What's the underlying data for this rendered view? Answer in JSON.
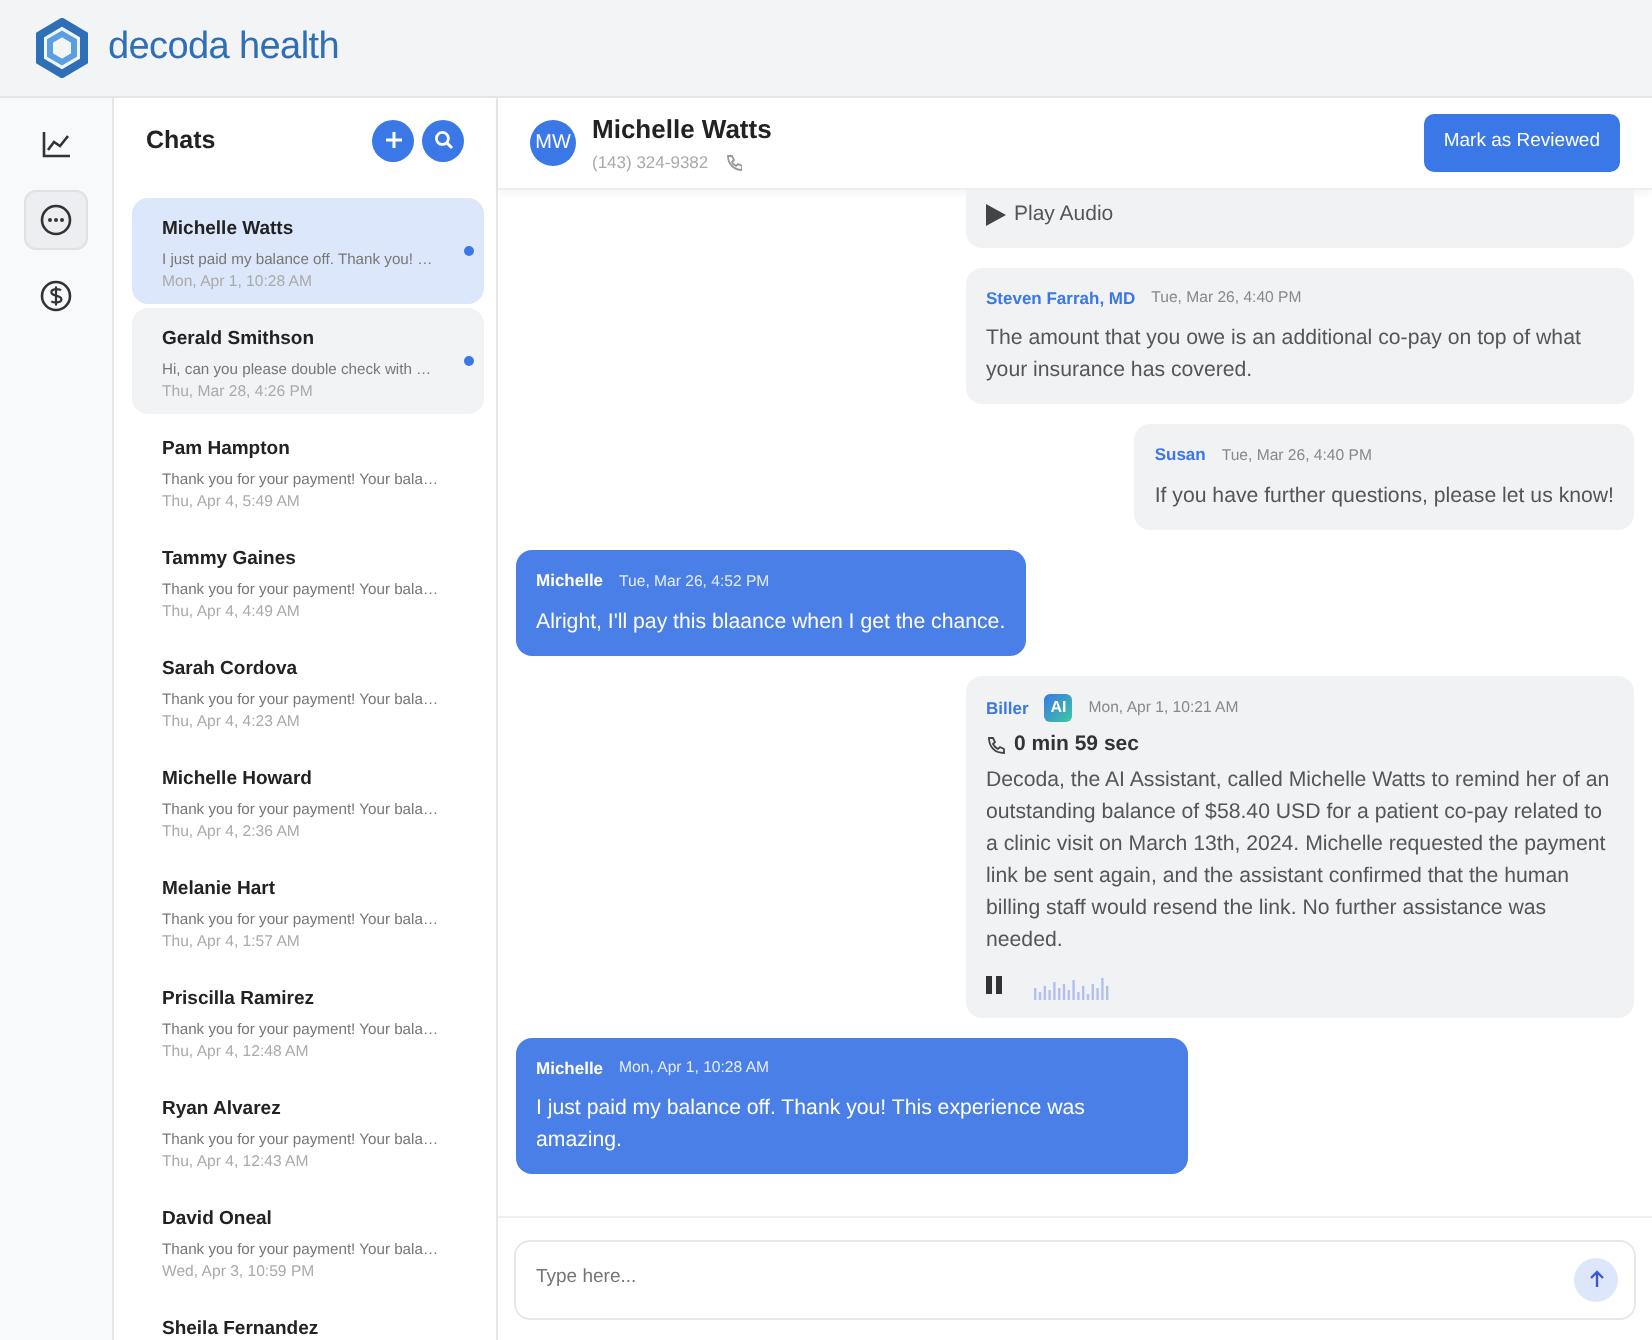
{
  "brand": {
    "name": "decoda health"
  },
  "rail": [
    {
      "kind": "chart",
      "selected": false
    },
    {
      "kind": "chat",
      "selected": true
    },
    {
      "kind": "dollar",
      "selected": false
    }
  ],
  "chats": {
    "title": "Chats",
    "items": [
      {
        "name": "Michelle Watts",
        "preview": "I just paid my balance off. Thank you! …",
        "time": "Mon, Apr 1, 10:28 AM",
        "selected": true,
        "unread": true
      },
      {
        "name": "Gerald Smithson",
        "preview": "Hi, can you please double check with …",
        "time": "Thu, Mar 28, 4:26 PM",
        "selected": false,
        "unread": true
      },
      {
        "name": "Pam Hampton",
        "preview": "Thank you for your payment! Your bala…",
        "time": "Thu, Apr 4, 5:49 AM",
        "selected": false,
        "unread": false
      },
      {
        "name": "Tammy Gaines",
        "preview": "Thank you for your payment! Your bala…",
        "time": "Thu, Apr 4, 4:49 AM",
        "selected": false,
        "unread": false
      },
      {
        "name": "Sarah Cordova",
        "preview": "Thank you for your payment! Your bala…",
        "time": "Thu, Apr 4, 4:23 AM",
        "selected": false,
        "unread": false
      },
      {
        "name": "Michelle Howard",
        "preview": "Thank you for your payment! Your bala…",
        "time": "Thu, Apr 4, 2:36 AM",
        "selected": false,
        "unread": false
      },
      {
        "name": "Melanie Hart",
        "preview": "Thank you for your payment! Your bala…",
        "time": "Thu, Apr 4, 1:57 AM",
        "selected": false,
        "unread": false
      },
      {
        "name": "Priscilla Ramirez",
        "preview": "Thank you for your payment! Your bala…",
        "time": "Thu, Apr 4, 12:48 AM",
        "selected": false,
        "unread": false
      },
      {
        "name": "Ryan Alvarez",
        "preview": "Thank you for your payment! Your bala…",
        "time": "Thu, Apr 4, 12:43 AM",
        "selected": false,
        "unread": false
      },
      {
        "name": "David Oneal",
        "preview": "Thank you for your payment! Your bala…",
        "time": "Wed, Apr 3, 10:59 PM",
        "selected": false,
        "unread": false
      },
      {
        "name": "Sheila Fernandez"
      }
    ]
  },
  "conversation": {
    "initials": "MW",
    "name": "Michelle Watts",
    "phone": "(143) 324-9382",
    "action": "Mark as Reviewed"
  },
  "messages": [
    {
      "kind": "audio",
      "label": "Play Audio"
    },
    {
      "kind": "staff",
      "sender": "Steven Farrah, MD",
      "time": "Tue, Mar 26, 4:40 PM",
      "text": "The amount that you owe is an additional co-pay on top of what your insurance has covered."
    },
    {
      "kind": "staff",
      "sender": "Susan",
      "time": "Tue, Mar 26, 4:40 PM",
      "text": "If you have further questions, please let us know!"
    },
    {
      "kind": "patient",
      "sender": "Michelle",
      "time": "Tue, Mar 26, 4:52 PM",
      "text": "Alright, I'll pay this blaance when I get the chance."
    },
    {
      "kind": "ai_call",
      "sender": "Biller",
      "badge": "AI",
      "time": "Mon, Apr 1, 10:21 AM",
      "duration": "0 min 59 sec",
      "text": "Decoda, the AI Assistant, called Michelle Watts to remind her of an outstanding balance of $58.40 USD for a patient co-pay related to a clinic visit on March 13th, 2024. Michelle requested the payment link be sent again, and the assistant confirmed that the human billing staff would resend the link. No further assistance was needed."
    },
    {
      "kind": "patient",
      "sender": "Michelle",
      "time": "Mon, Apr 1, 10:28 AM",
      "text": "I just paid my balance off. Thank you! This experience was amazing."
    }
  ],
  "composer": {
    "placeholder": "Type here..."
  }
}
